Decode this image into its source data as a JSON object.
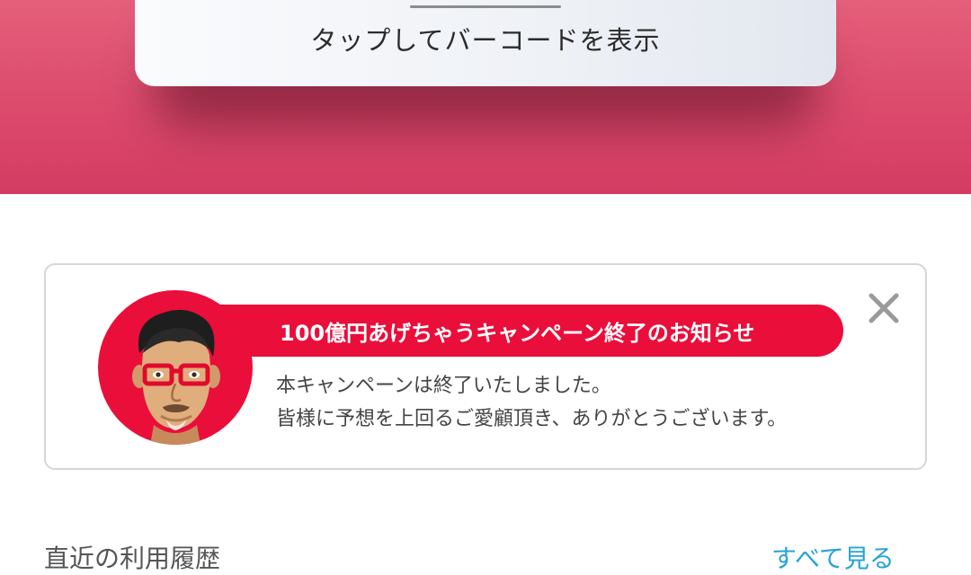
{
  "barcode_card": {
    "label": "タップしてバーコードを表示"
  },
  "notice": {
    "title": "100億円あげちゃうキャンペーン終了のお知らせ",
    "line1": "本キャンペーンは終了いたしました。",
    "line2": "皆様に予想を上回るご愛顧頂き、ありがとうございます。",
    "icons": {
      "close": "close-icon",
      "avatar": "mascot-avatar"
    }
  },
  "history": {
    "title": "直近の利用履歴",
    "see_all": "すべて見る"
  },
  "colors": {
    "hero_top": "#e45f7a",
    "hero_bottom": "#d33c62",
    "banner": "#ea0e3a",
    "link": "#26a4d8"
  }
}
